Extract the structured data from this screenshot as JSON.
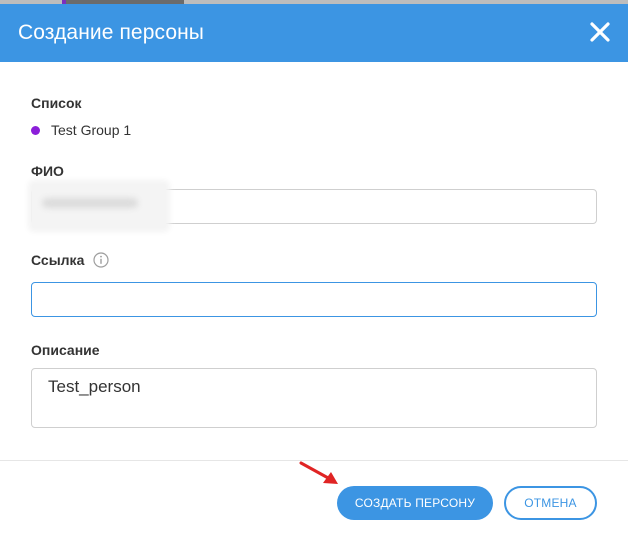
{
  "dialog": {
    "title": "Создание персоны",
    "close_icon": "close-icon"
  },
  "list": {
    "label": "Список",
    "group_name": "Test Group 1",
    "group_color": "#8b1ed9"
  },
  "fio": {
    "label": "ФИО",
    "value": ""
  },
  "link": {
    "label": "Ссылка",
    "info_icon": "info-icon",
    "value": "",
    "placeholder": ""
  },
  "description": {
    "label": "Описание",
    "value": "Test_person"
  },
  "actions": {
    "create_label": "СОЗДАТЬ ПЕРСОНУ",
    "cancel_label": "ОТМЕНА"
  },
  "annotation": {
    "arrow_icon": "red-arrow-icon",
    "arrow_color": "#e02424"
  },
  "colors": {
    "accent": "#3c95e3"
  }
}
